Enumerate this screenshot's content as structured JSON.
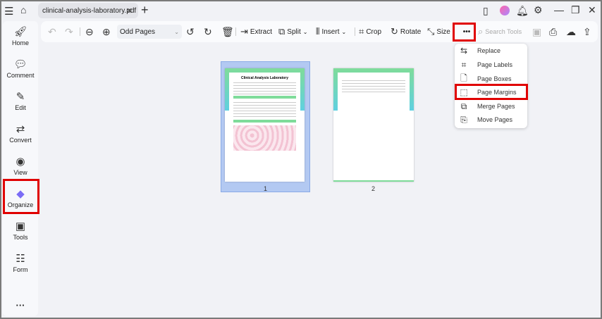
{
  "titlebar": {
    "tab_title": "clinical-analysis-laboratory.pdf"
  },
  "sidebar": {
    "items": [
      {
        "label": "Home"
      },
      {
        "label": "Comment"
      },
      {
        "label": "Edit"
      },
      {
        "label": "Convert"
      },
      {
        "label": "View"
      },
      {
        "label": "Organize"
      },
      {
        "label": "Tools"
      },
      {
        "label": "Form"
      }
    ]
  },
  "toolbar": {
    "page_filter": "Odd Pages",
    "extract": "Extract",
    "split": "Split",
    "insert": "Insert",
    "crop": "Crop",
    "rotate": "Rotate",
    "size": "Size",
    "more": "•••",
    "search_placeholder": "Search Tools"
  },
  "menu": {
    "items": [
      {
        "label": "Replace"
      },
      {
        "label": "Page Labels"
      },
      {
        "label": "Page Boxes"
      },
      {
        "label": "Page Margins"
      },
      {
        "label": "Merge Pages"
      },
      {
        "label": "Move Pages"
      }
    ]
  },
  "pages": [
    {
      "number": "1",
      "title": "Clinical Analysis Laboratory"
    },
    {
      "number": "2"
    }
  ],
  "colors": {
    "highlight": "#e00000",
    "selected_page": "#b3c9f2",
    "accent_green": "#7fdc9a",
    "accent_teal": "#5fd0e0"
  }
}
